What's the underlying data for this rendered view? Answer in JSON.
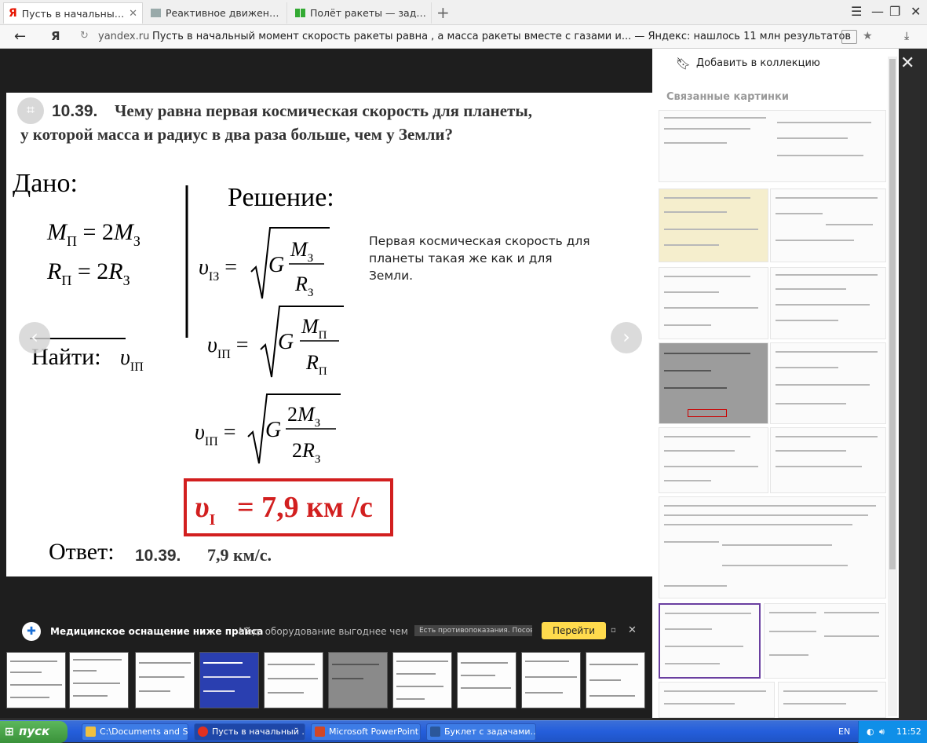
{
  "tabs": [
    {
      "title": "Пусть в начальный моме",
      "active": true,
      "favicon": "yandex-icon"
    },
    {
      "title": "Реактивное движение — пр",
      "active": false,
      "favicon": "gear-icon"
    },
    {
      "title": "Полёт ракеты — задание. ¢",
      "active": false,
      "favicon": "green-squares-icon"
    }
  ],
  "address": {
    "logo": "Я",
    "domain": "yandex.ru",
    "title": "Пусть в начальный момент скорость ракеты равна , а масса ракеты вместе с газами и... — Яндекс: нашлось 11 млн результатов"
  },
  "image": {
    "heading_num": "10.39.",
    "heading_text": "Чему равна первая космическая скорость для планеты,",
    "heading_text2": "у которой масса и радиус в два раза больше, чем у Земли?",
    "dano": "Дано:",
    "m_line": "M",
    "r_line": "R",
    "najti": "Найти:",
    "reshenie": "Решение:",
    "note": "Первая космическая скорость для планеты такая же как и для Земли.",
    "result": "v",
    "result_value": "= 7,9 км /с",
    "otvet": "Ответ:",
    "otvet_num": "10.39.",
    "otvet_val": "7,9 км/с."
  },
  "sidebar": {
    "add_collection": "Добавить в коллекцию",
    "related": "Связанные картинки"
  },
  "ad": {
    "title": "Медицинское оснащение ниже прайса",
    "text": "Мед. оборудование выгоднее чем у ...",
    "disclaimer": "Есть противопоказания. Посов",
    "button": "Перейти"
  },
  "taskbar": {
    "start": "пуск",
    "items": [
      {
        "label": "C:\\Documents and Se...",
        "icon_color": "#f0c040"
      },
      {
        "label": "Пусть в начальный ...",
        "icon_color": "#e03020",
        "active": true
      },
      {
        "label": "Microsoft PowerPoint ...",
        "icon_color": "#d24726"
      },
      {
        "label": "Буклет с задачами....",
        "icon_color": "#2b579a"
      }
    ],
    "lang": "EN",
    "time": "11:52"
  }
}
